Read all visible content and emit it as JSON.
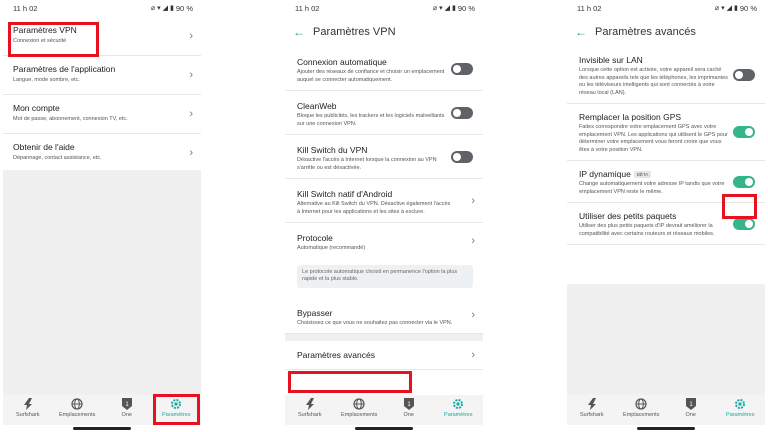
{
  "colors": {
    "accent": "#1aa7a0",
    "toggle_on": "#35b58c",
    "toggle_off": "#5f6368",
    "highlight": "#e8111f"
  },
  "status": {
    "time": "11 h 02",
    "battery": "90 %"
  },
  "nav": {
    "items": [
      {
        "label": "Surfshark",
        "icon": "surfshark-logo-icon"
      },
      {
        "label": "Emplacements",
        "icon": "globe-icon"
      },
      {
        "label": "One",
        "icon": "one-shield-icon"
      },
      {
        "label": "Paramètres",
        "icon": "gear-icon"
      }
    ]
  },
  "screen1": {
    "items": [
      {
        "title": "Paramètres VPN",
        "subtitle": "Connexion et sécurité"
      },
      {
        "title": "Paramètres de l'application",
        "subtitle": "Langue, mode sombre, etc."
      },
      {
        "title": "Mon compte",
        "subtitle": "Mot de passe, abonnement, connexion TV, etc."
      },
      {
        "title": "Obtenir de l'aide",
        "subtitle": "Dépannage, contact assistance, etc."
      }
    ]
  },
  "screen2": {
    "title": "Paramètres VPN",
    "rows": [
      {
        "title": "Connexion automatique",
        "desc": "Ajouter des réseaux de confiance et choisir un emplacement auquel se connecter automatiquement.",
        "toggle": false
      },
      {
        "title": "CleanWeb",
        "desc": "Bloque les publicités, les trackers et les logiciels malveillants sur une connexion VPN.",
        "toggle": false
      },
      {
        "title": "Kill Switch du VPN",
        "desc": "Désactive l'accès à Internet lorsque la connexion au VPN s'arrête ou est désactivée.",
        "toggle": false
      },
      {
        "title": "Kill Switch natif d'Android",
        "desc": "Alternative au Kill Switch du VPN. Désactive également l'accès à Internet pour les applications et les sites à exclure."
      },
      {
        "title": "Protocole",
        "desc": "Automatique (recommandé)"
      },
      {
        "title": "Bypasser",
        "desc": "Choisissez ce que vous ne souhaitez pas connecter via le VPN."
      }
    ],
    "protocol_note": "Le protocole automatique choisit en permanence l'option la plus rapide et la plus stable.",
    "advanced": "Paramètres avancés"
  },
  "screen3": {
    "title": "Paramètres avancés",
    "rows": [
      {
        "title": "Invisible sur LAN",
        "desc": "Lorsque cette option est activée, votre appareil sera caché des autres appareils tels que les téléphones, les imprimantes ou les téléviseurs intelligents qui sont connectés à votre réseau local (LAN).",
        "toggle": false
      },
      {
        "title": "Remplacer la position GPS",
        "desc": "Faites correspondre votre emplacement GPS avec votre emplacement VPN. Les applications qui utilisent le GPS pour déterminer votre emplacement vous feront croire que vous êtes à votre position VPN.",
        "toggle": true
      },
      {
        "title": "IP dynamique",
        "badge": "BÊTA",
        "desc": "Change automatiquement votre adresse IP tandis que votre emplacement VPN reste le même.",
        "toggle": true
      },
      {
        "title": "Utiliser des petits paquets",
        "desc": "Utiliser des plus petits paquets d'IP devrait améliorer la compatibilité avec certains routeurs et réseaux mobiles.",
        "toggle": true
      }
    ]
  }
}
